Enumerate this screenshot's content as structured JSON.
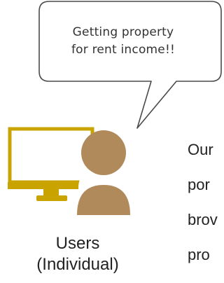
{
  "speech_bubble": {
    "line1": "Getting property",
    "line2": "for rent income!!"
  },
  "user": {
    "label_line1": "Users",
    "label_line2": "(Individual)"
  },
  "side_text": [
    "Our",
    "por",
    "brov",
    "pro"
  ],
  "icons": {
    "monitor": "monitor-icon",
    "person": "person-icon"
  },
  "colors": {
    "monitor": "#c9a400",
    "person": "#b08a5a",
    "bubble_stroke": "#4a4a4a"
  }
}
